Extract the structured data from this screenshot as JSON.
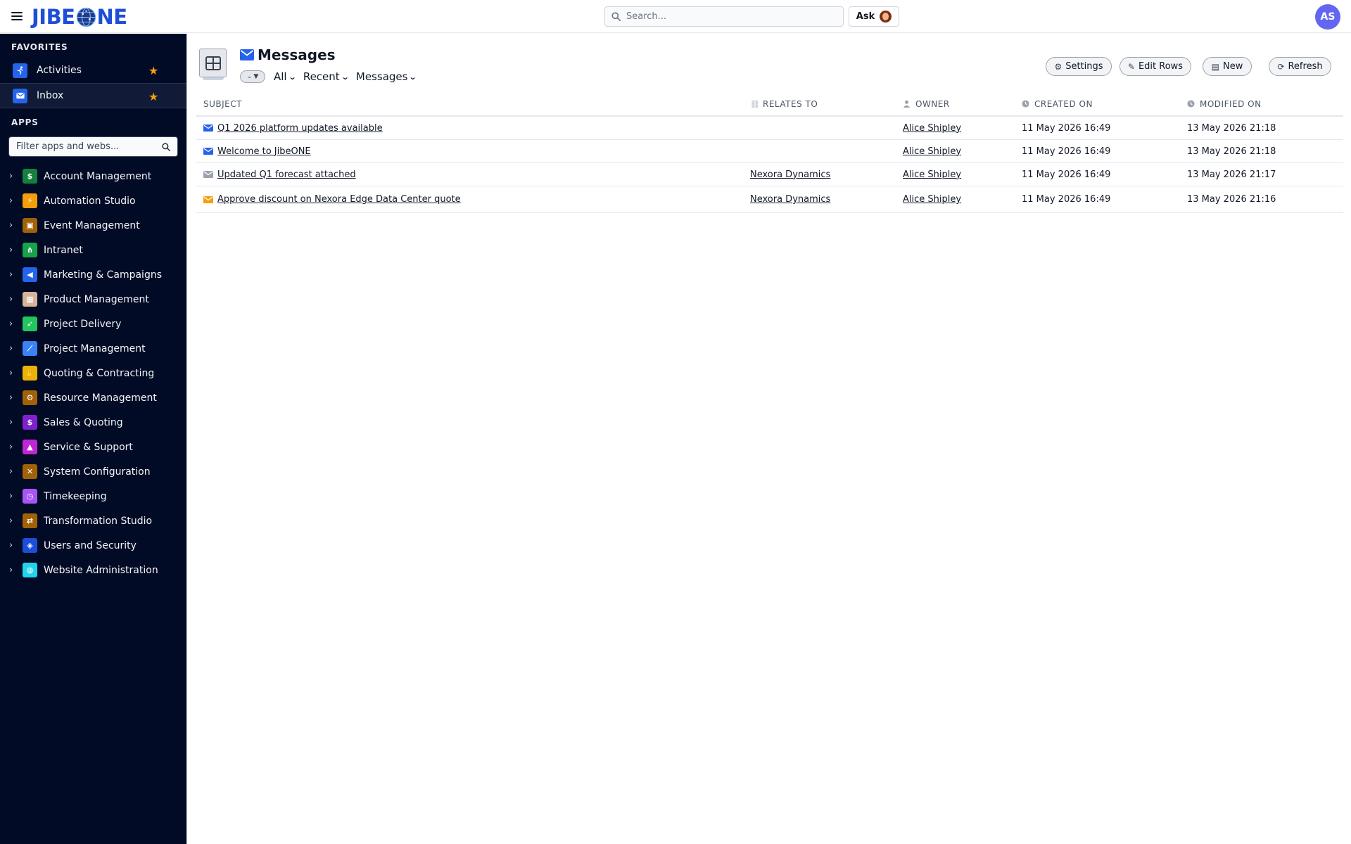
{
  "app": {
    "logo_text_left": "JIBE",
    "logo_text_right": "NE"
  },
  "header": {
    "search_placeholder": "Search...",
    "ask_label": "Ask",
    "user_initials": "AS"
  },
  "sidebar": {
    "favorites_label": "FAVORITES",
    "favorites": [
      {
        "label": "Activities",
        "icon": "running-icon",
        "color": "#2563eb"
      },
      {
        "label": "Inbox",
        "icon": "envelope-icon",
        "color": "#2563eb"
      }
    ],
    "apps_label": "APPS",
    "filter_placeholder": "Filter apps and webs...",
    "apps": [
      {
        "label": "Account Management",
        "icon": "hand-money-icon",
        "color": "#15803d"
      },
      {
        "label": "Automation Studio",
        "icon": "bolt-icon",
        "color": "#f59e0b"
      },
      {
        "label": "Event Management",
        "icon": "hand-calendar-icon",
        "color": "#a16207"
      },
      {
        "label": "Intranet",
        "icon": "sitemap-icon",
        "color": "#16a34a"
      },
      {
        "label": "Marketing & Campaigns",
        "icon": "megaphone-icon",
        "color": "#2563eb"
      },
      {
        "label": "Product Management",
        "icon": "box-icon",
        "color": "#d6b49a"
      },
      {
        "label": "Project Delivery",
        "icon": "rocket-icon",
        "color": "#22c55e"
      },
      {
        "label": "Project Management",
        "icon": "chart-line-icon",
        "color": "#3b82f6"
      },
      {
        "label": "Quoting & Contracting",
        "icon": "handshake-icon",
        "color": "#eab308"
      },
      {
        "label": "Resource Management",
        "icon": "user-gear-icon",
        "color": "#a16207"
      },
      {
        "label": "Sales & Quoting",
        "icon": "hand-dollar-icon",
        "color": "#7e22ce"
      },
      {
        "label": "Service & Support",
        "icon": "bell-icon",
        "color": "#c026d3"
      },
      {
        "label": "System Configuration",
        "icon": "tools-icon",
        "color": "#a16207"
      },
      {
        "label": "Timekeeping",
        "icon": "clock-icon",
        "color": "#a855f7"
      },
      {
        "label": "Transformation Studio",
        "icon": "arrows-exchange-icon",
        "color": "#a16207"
      },
      {
        "label": "Users and Security",
        "icon": "shield-icon",
        "color": "#1d4ed8"
      },
      {
        "label": "Website Administration",
        "icon": "globe-icon",
        "color": "#22d3ee"
      }
    ]
  },
  "main": {
    "title": "Messages",
    "filters": {
      "scope": "All",
      "sort": "Recent",
      "view": "Messages"
    },
    "buttons": {
      "settings": "Settings",
      "edit_rows": "Edit Rows",
      "new": "New",
      "refresh": "Refresh"
    },
    "columns": {
      "subject": "SUBJECT",
      "relates_to": "RELATES TO",
      "owner": "OWNER",
      "created_on": "CREATED ON",
      "modified_on": "MODIFIED ON"
    },
    "rows": [
      {
        "subject": "Q1 2026 platform updates available",
        "relates_to": "",
        "owner": "Alice Shipley",
        "created_on": "11 May 2026 16:49",
        "modified_on": "13 May 2026 21:18",
        "icon_color": "#2563eb"
      },
      {
        "subject": "Welcome to JibeONE",
        "relates_to": "",
        "owner": "Alice Shipley",
        "created_on": "11 May 2026 16:49",
        "modified_on": "13 May 2026 21:18",
        "icon_color": "#2563eb"
      },
      {
        "subject": "Updated Q1 forecast attached",
        "relates_to": "Nexora Dynamics",
        "owner": "Alice Shipley",
        "created_on": "11 May 2026 16:49",
        "modified_on": "13 May 2026 21:17",
        "icon_color": "#9ca3af"
      },
      {
        "subject": "Approve discount on Nexora Edge Data Center quote",
        "relates_to": "Nexora Dynamics",
        "owner": "Alice Shipley",
        "created_on": "11 May 2026 16:49",
        "modified_on": "13 May 2026 21:16",
        "icon_color": "#f59e0b"
      }
    ]
  }
}
